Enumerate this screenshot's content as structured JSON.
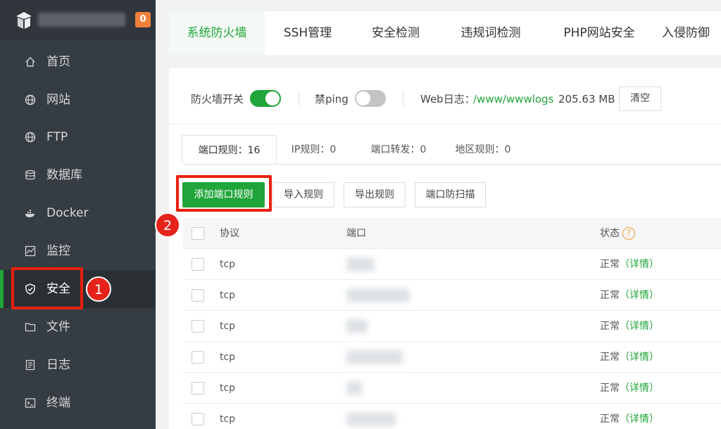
{
  "sidebar": {
    "badge_count": "0",
    "items": [
      {
        "label": "首页",
        "icon": "home-icon"
      },
      {
        "label": "网站",
        "icon": "globe-icon"
      },
      {
        "label": "FTP",
        "icon": "globe-icon"
      },
      {
        "label": "数据库",
        "icon": "database-icon"
      },
      {
        "label": "Docker",
        "icon": "docker-icon"
      },
      {
        "label": "监控",
        "icon": "chart-icon"
      },
      {
        "label": "安全",
        "icon": "shield-icon"
      },
      {
        "label": "文件",
        "icon": "folder-icon"
      },
      {
        "label": "日志",
        "icon": "document-icon"
      },
      {
        "label": "终端",
        "icon": "terminal-icon"
      }
    ],
    "active_index": 6
  },
  "annotations": {
    "step1": "1",
    "step2": "2",
    "highlight_color": "#e8200f"
  },
  "top_tabs": [
    "系统防火墙",
    "SSH管理",
    "安全检测",
    "违规词检测",
    "PHP网站安全",
    "入侵防御"
  ],
  "controls": {
    "firewall_label": "防火墙开关",
    "firewall_on": true,
    "ping_label": "禁ping",
    "ping_on": false,
    "weblog_label": "Web日志：",
    "weblog_path": "/www/wwwlogs",
    "weblog_size": "205.63 MB",
    "clear_button": "清空"
  },
  "sub_tabs": [
    "端口规则：16",
    "IP规则：0",
    "端口转发：0",
    "地区规则：0"
  ],
  "actions": {
    "add": "添加端口规则",
    "import": "导入规则",
    "export": "导出规则",
    "scan": "端口防扫描"
  },
  "table": {
    "headers": {
      "protocol": "协议",
      "port": "端口",
      "status": "状态"
    },
    "status_help_icon": "?",
    "rows": [
      {
        "protocol": "tcp",
        "status": "正常",
        "detail": "（详情）"
      },
      {
        "protocol": "tcp",
        "status": "正常",
        "detail": "（详情）"
      },
      {
        "protocol": "tcp",
        "status": "正常",
        "detail": "（详情）"
      },
      {
        "protocol": "tcp",
        "status": "正常",
        "detail": "（详情）"
      },
      {
        "protocol": "tcp",
        "status": "正常",
        "detail": "（详情）"
      },
      {
        "protocol": "tcp",
        "status": "正常",
        "detail": "（详情）"
      }
    ]
  },
  "colors": {
    "accent": "#20a53a",
    "sidebar_bg": "#353c42",
    "badge": "#f0803c"
  }
}
